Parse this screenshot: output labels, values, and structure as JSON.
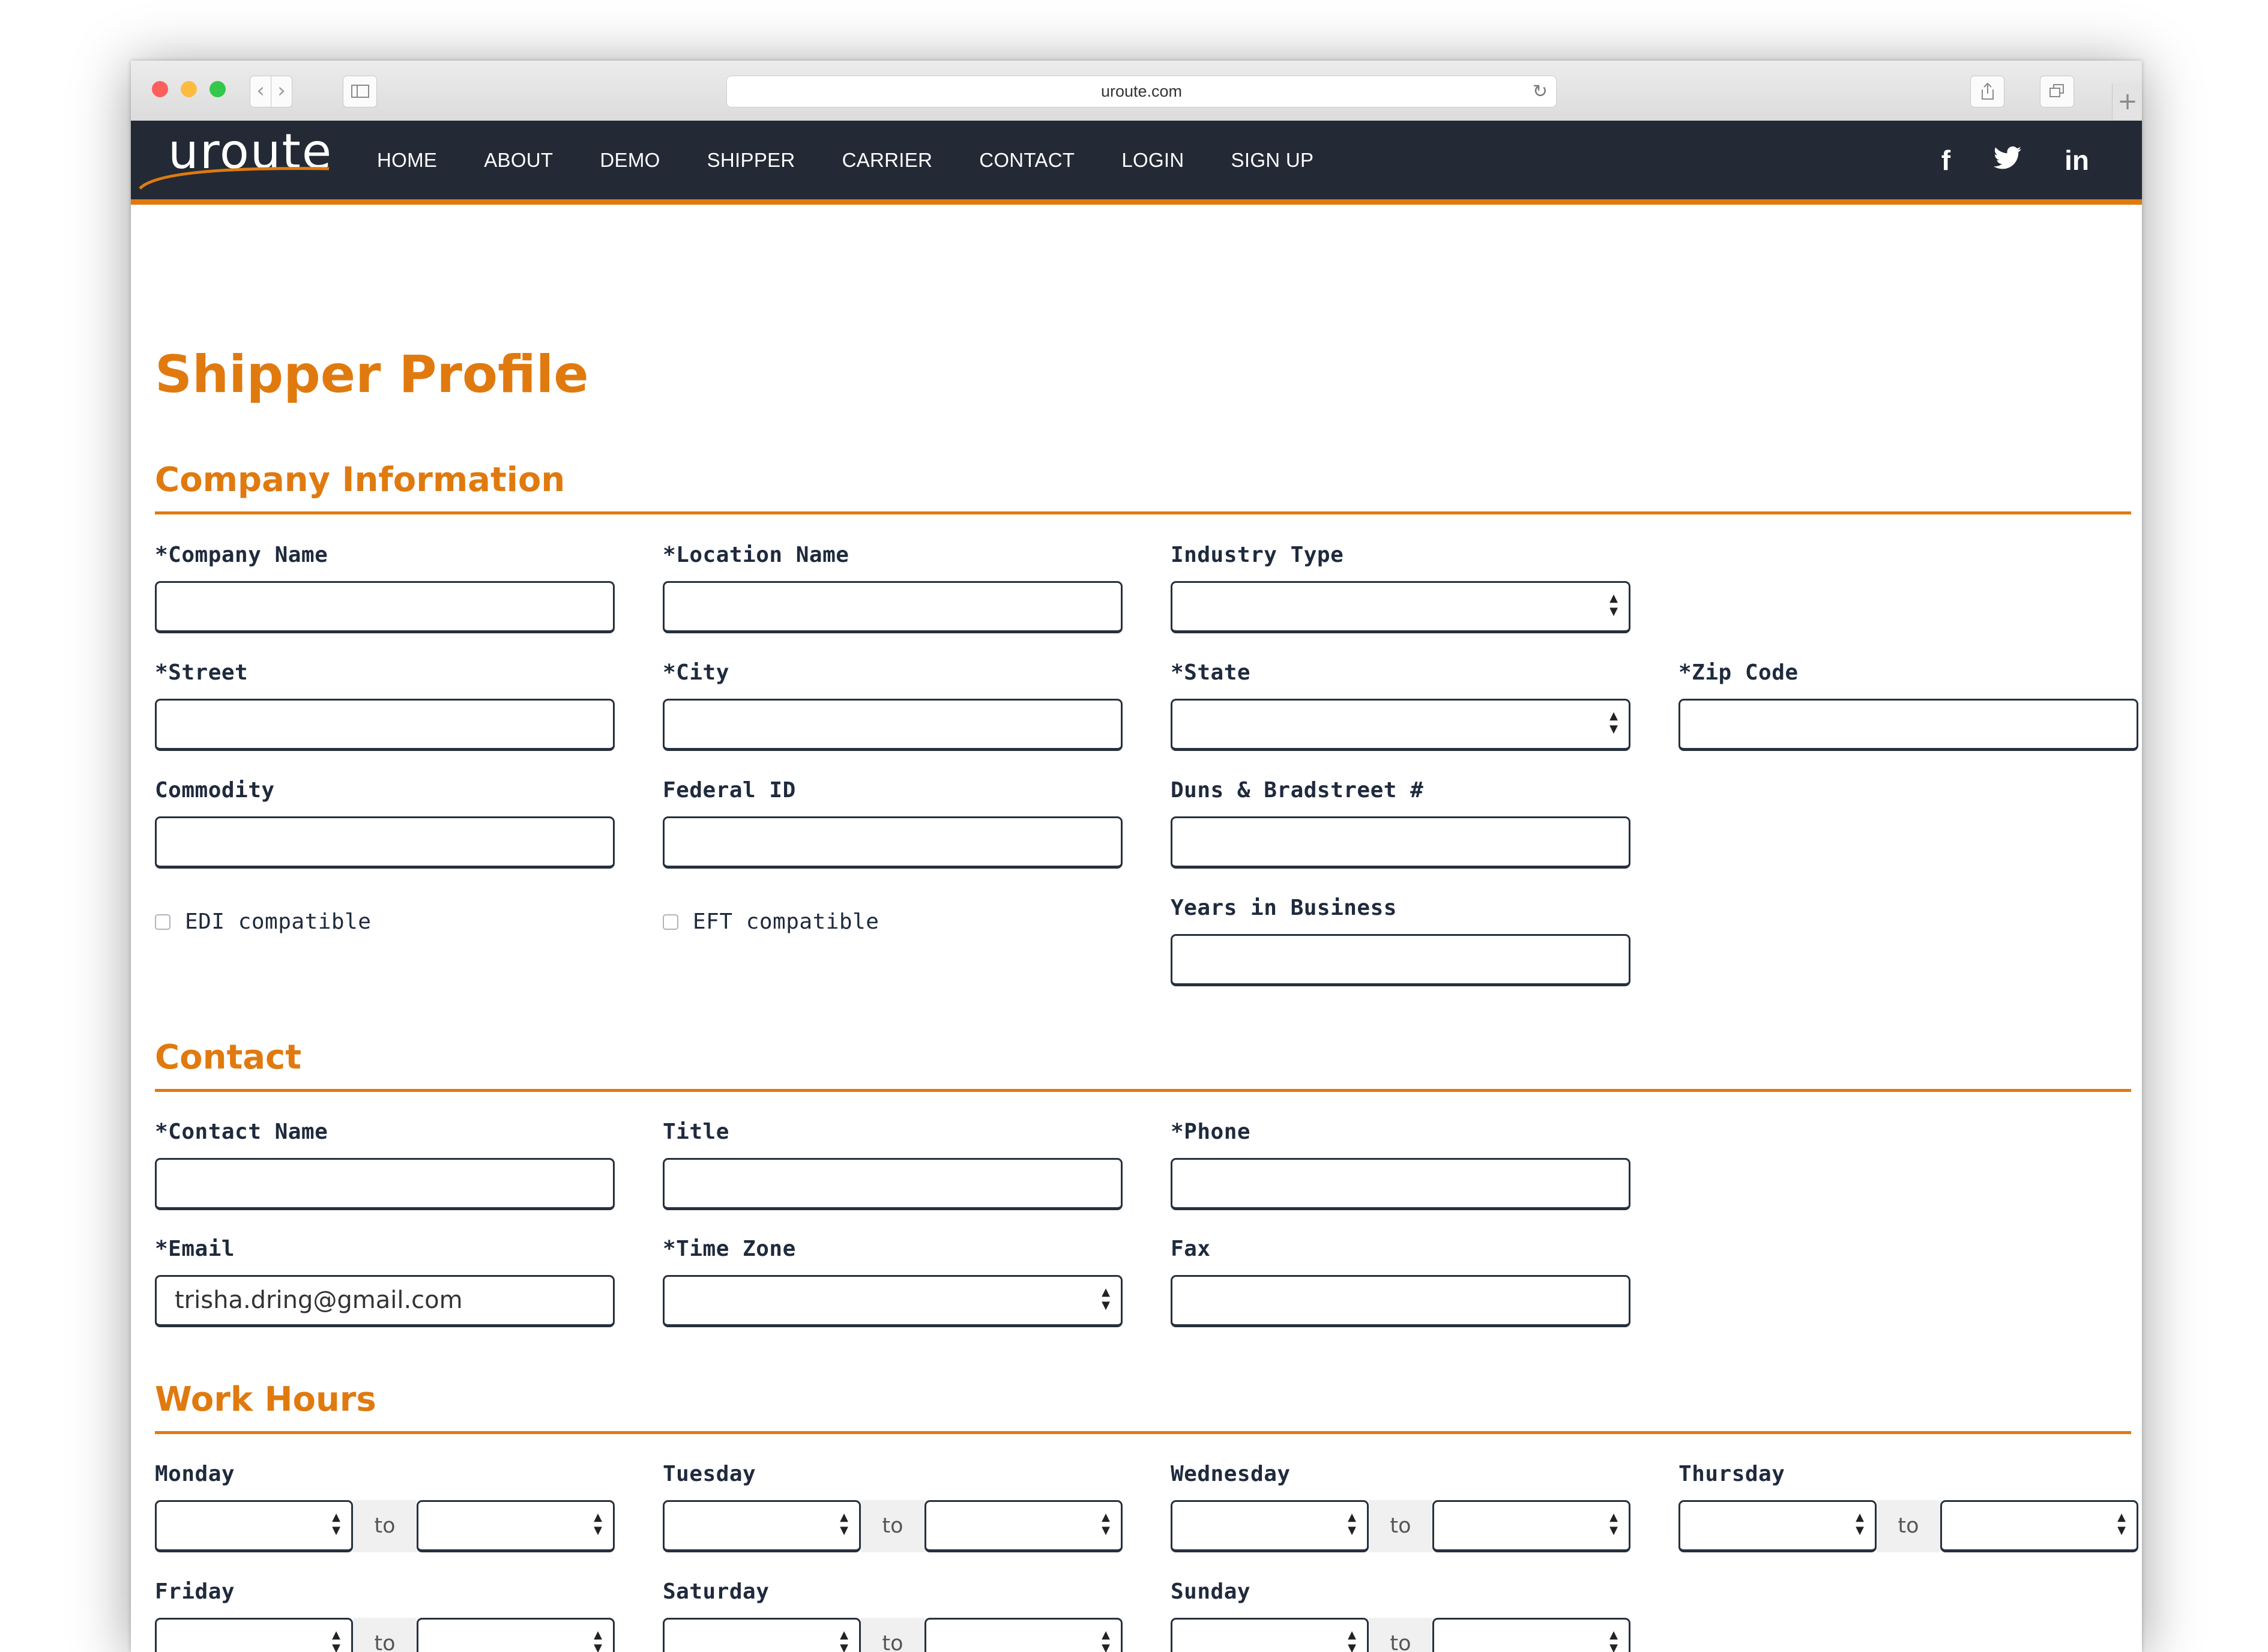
{
  "browser": {
    "url": "uroute.com"
  },
  "site": {
    "logo": "uroute",
    "nav": [
      "HOME",
      "ABOUT",
      "DEMO",
      "SHIPPER",
      "CARRIER",
      "CONTACT",
      "LOGIN",
      "SIGN UP"
    ],
    "social": [
      "f",
      "t",
      "in"
    ],
    "social_icons": [
      "facebook-icon",
      "twitter-icon",
      "linkedin-icon"
    ],
    "accent_color": "#e07a0f",
    "nav_background": "#232a35"
  },
  "page": {
    "title": "Shipper Profile"
  },
  "company": {
    "heading": "Company Information",
    "company_name": {
      "label": "*Company Name",
      "value": ""
    },
    "location_name": {
      "label": "*Location Name",
      "value": ""
    },
    "industry_type": {
      "label": "Industry Type",
      "value": ""
    },
    "street": {
      "label": "*Street",
      "value": ""
    },
    "city": {
      "label": "*City",
      "value": ""
    },
    "state": {
      "label": "*State",
      "value": ""
    },
    "zip": {
      "label": "*Zip Code",
      "value": ""
    },
    "commodity": {
      "label": "Commodity",
      "value": ""
    },
    "federal_id": {
      "label": "Federal ID",
      "value": ""
    },
    "duns": {
      "label": "Duns & Bradstreet #",
      "value": ""
    },
    "edi": {
      "label": "EDI compatible",
      "checked": false
    },
    "eft": {
      "label": "EFT compatible",
      "checked": false
    },
    "years": {
      "label": "Years in Business",
      "value": ""
    }
  },
  "contact": {
    "heading": "Contact",
    "name": {
      "label": "*Contact Name",
      "value": ""
    },
    "title": {
      "label": "Title",
      "value": ""
    },
    "phone": {
      "label": "*Phone",
      "value": ""
    },
    "email": {
      "label": "*Email",
      "value": "trisha.dring@gmail.com"
    },
    "timezone": {
      "label": "*Time Zone",
      "value": ""
    },
    "fax": {
      "label": "Fax",
      "value": ""
    }
  },
  "hours": {
    "heading": "Work Hours",
    "to_label": "to",
    "days": [
      "Monday",
      "Tuesday",
      "Wednesday",
      "Thursday",
      "Friday",
      "Saturday",
      "Sunday"
    ]
  }
}
